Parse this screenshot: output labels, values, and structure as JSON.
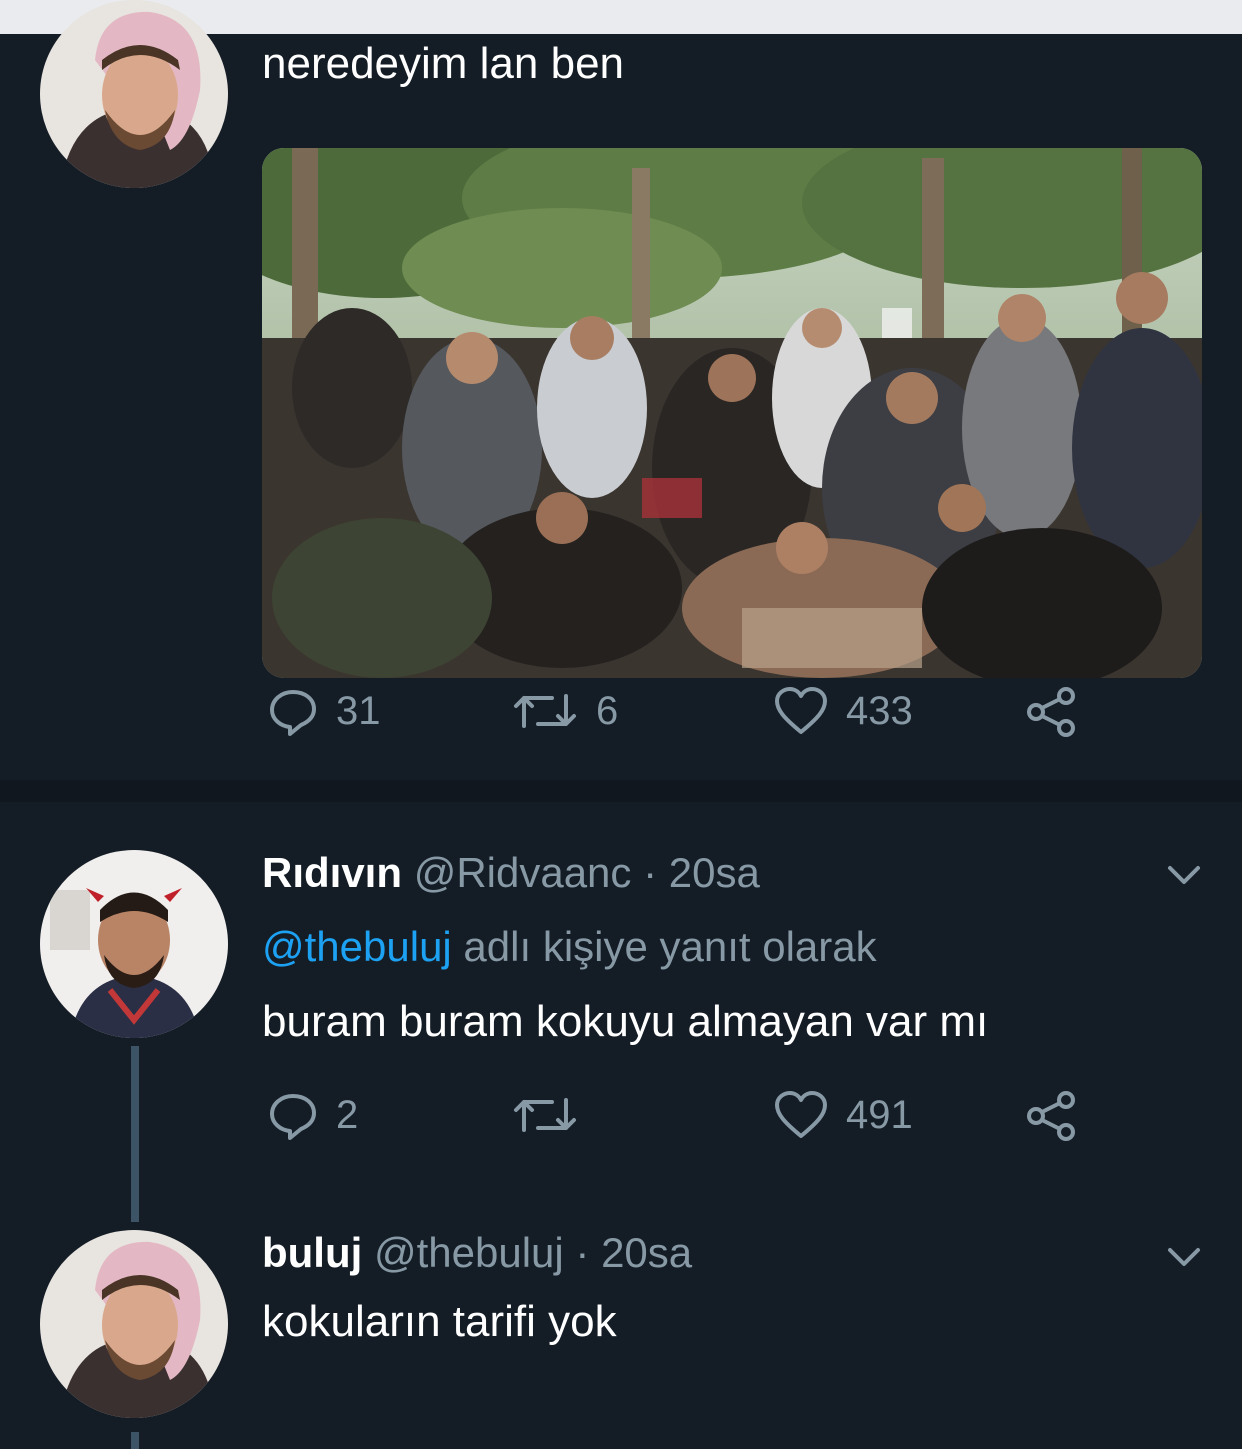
{
  "colors": {
    "background": "#141d26",
    "separator": "#10171e",
    "text": "#ffffff",
    "muted": "#8899a6",
    "mention": "#1da1f2",
    "thread_line": "#3d5466"
  },
  "tweets": [
    {
      "text": "neredeyim lan ben",
      "has_media": true,
      "actions": {
        "replies": "31",
        "retweets": "6",
        "likes": "433"
      }
    },
    {
      "name": "Rıdıvın",
      "handle": "@Ridvaanc",
      "time": "· 20sa",
      "reply_mention": "@thebuluj",
      "reply_suffix": " adlı kişiye yanıt olarak",
      "text": "buram buram kokuyu almayan var mı",
      "actions": {
        "replies": "2",
        "retweets": "",
        "likes": "491"
      }
    },
    {
      "name": "buluj",
      "handle": "@thebuluj",
      "time": "· 20sa",
      "text": "kokuların tarifi yok"
    }
  ],
  "icons": {
    "reply": "reply-icon",
    "retweet": "retweet-icon",
    "like": "heart-icon",
    "share": "share-icon",
    "more": "chevron-down-icon"
  }
}
